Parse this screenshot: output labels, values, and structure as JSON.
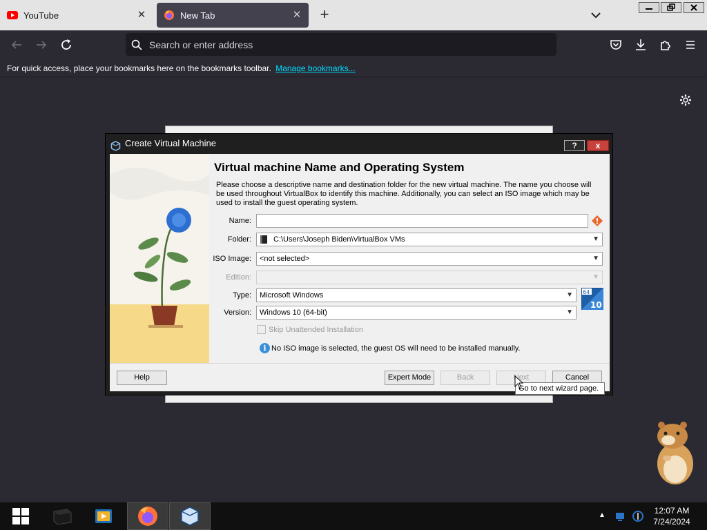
{
  "browser": {
    "tabs": [
      {
        "label": "YouTube",
        "active": false
      },
      {
        "label": "New Tab",
        "active": true
      }
    ],
    "window_controls": [
      "minimize",
      "restore",
      "close"
    ],
    "address_placeholder": "Search or enter address",
    "bookmarks_bar": {
      "message": "For quick access, place your bookmarks here on the bookmarks toolbar.",
      "link": "Manage bookmarks..."
    },
    "accent_color": "#00ddff"
  },
  "dialog": {
    "title": "Create Virtual Machine",
    "help_glyph": "?",
    "close_glyph": "x",
    "heading": "Virtual machine Name and Operating System",
    "description": "Please choose a descriptive name and destination folder for the new virtual machine. The name you choose will be used throughout VirtualBox to identify this machine. Additionally, you can select an ISO image which may be used to install the guest operating system.",
    "fields": {
      "name": {
        "label": "Name:",
        "value": ""
      },
      "folder": {
        "label": "Folder:",
        "value": "C:\\Users\\Joseph Biden\\VirtualBox VMs"
      },
      "iso": {
        "label": "ISO Image:",
        "value": "<not selected>"
      },
      "edition": {
        "label": "Edition:",
        "value": ""
      },
      "type": {
        "label": "Type:",
        "value": "Microsoft Windows"
      },
      "version": {
        "label": "Version:",
        "value": "Windows 10 (64-bit)"
      }
    },
    "os_badge": {
      "bits": "64",
      "version": "10"
    },
    "skip_unattended": {
      "label": "Skip Unattended Installation",
      "checked": false,
      "enabled": false
    },
    "info_message": "No ISO image is selected, the guest OS will need to be installed manually.",
    "buttons": {
      "help": "Help",
      "expert": "Expert Mode",
      "back": "Back",
      "next": "Next",
      "cancel": "Cancel"
    },
    "tooltip": "Go to next wizard page."
  },
  "taskbar": {
    "apps": [
      "start",
      "terminal",
      "media-player",
      "firefox",
      "virtualbox"
    ],
    "clock": {
      "time": "12:07 AM",
      "date": "7/24/2024"
    }
  }
}
